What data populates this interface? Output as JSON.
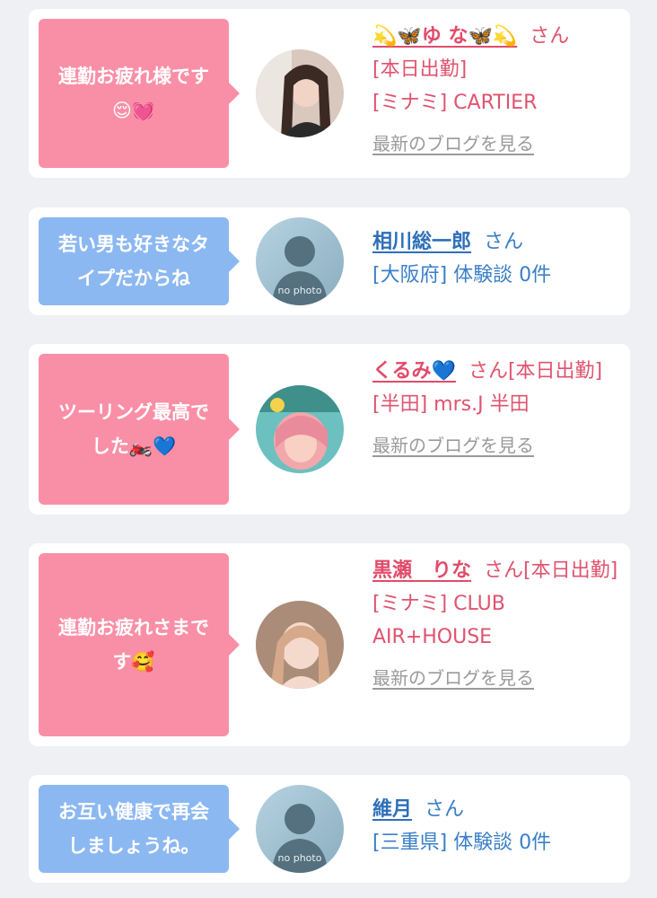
{
  "cards": [
    {
      "message": "連勤お疲れ様です😌💓",
      "name": "💫🦋ゆ な🦋💫",
      "suffix": "さん",
      "lines": [
        "[本日出勤]",
        "[ミナミ] CARTIER"
      ],
      "blog_link": "最新のブログを見る"
    },
    {
      "message": "若い男も好きなタイプだからね",
      "name": "相川総一郎",
      "suffix": "さん",
      "lines": [
        "[大阪府] 体験談 0件"
      ],
      "avatar_text": "no photo"
    },
    {
      "message": "ツーリング最高でした🏍️💙",
      "name": "くるみ💙",
      "suffix": "さん[本日出勤]",
      "lines": [
        "[半田] mrs.J 半田"
      ],
      "blog_link": "最新のブログを見る"
    },
    {
      "message": "連勤お疲れさまです🥰",
      "name": "黒瀬　りな",
      "suffix": "さん[本日出勤]",
      "lines": [
        "[ミナミ] CLUB AIR+HOUSE"
      ],
      "blog_link": "最新のブログを見る"
    },
    {
      "message": "お互い健康で再会しましょうね。",
      "name": "維月",
      "suffix": "さん",
      "lines": [
        "[三重県] 体験談 0件"
      ],
      "avatar_text": "no photo"
    }
  ],
  "colors": {
    "pink_bubble": "#f98fa6",
    "blue_bubble": "#8cb8f2",
    "pink_text": "#e0536f",
    "blue_text": "#3a7fc8",
    "link_gray": "#9a9a9a",
    "background": "#eef0f4"
  },
  "icons": {
    "avatar_placeholder": "silhouette-icon"
  }
}
